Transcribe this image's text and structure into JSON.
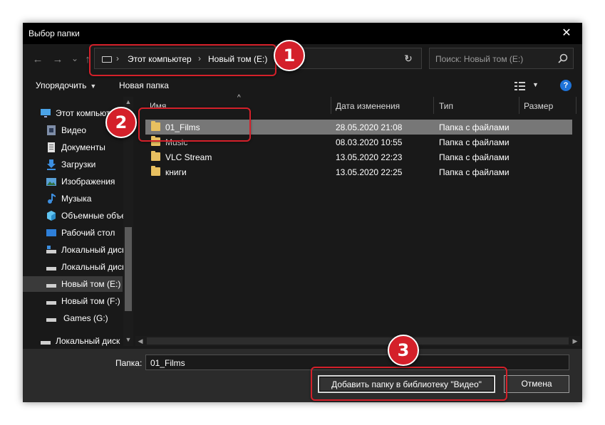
{
  "window": {
    "title": "Выбор папки",
    "close_glyph": "✕"
  },
  "nav": {
    "back_glyph": "←",
    "forward_glyph": "→",
    "history_glyph": "⌄",
    "up_glyph": "↑",
    "breadcrumbs": [
      "Этот компьютер",
      "Новый том (E:)"
    ],
    "crumb_sep": "›",
    "dropdown_glyph": "⌄",
    "refresh_glyph": "↻",
    "search_placeholder": "Поиск: Новый том (E:)"
  },
  "toolbar": {
    "organize": "Упорядочить",
    "new_folder": "Новая папка",
    "dropdown_glyph": "▼",
    "view_dropdown_glyph": "▼",
    "help_glyph": "?"
  },
  "sidebar": {
    "items": [
      {
        "label": "Этот компьютер",
        "icon": "computer-icon"
      },
      {
        "label": "Видео",
        "icon": "video-icon"
      },
      {
        "label": "Документы",
        "icon": "documents-icon"
      },
      {
        "label": "Загрузки",
        "icon": "downloads-icon"
      },
      {
        "label": "Изображения",
        "icon": "pictures-icon"
      },
      {
        "label": "Музыка",
        "icon": "music-icon"
      },
      {
        "label": "Объемные объекты",
        "icon": "3d-objects-icon"
      },
      {
        "label": "Рабочий стол",
        "icon": "desktop-icon"
      },
      {
        "label": "Локальный диск",
        "icon": "drive-icon"
      },
      {
        "label": "Локальный диск",
        "icon": "drive-icon"
      },
      {
        "label": "Новый том (E:)",
        "icon": "drive-icon"
      },
      {
        "label": "Новый том (F:)",
        "icon": "drive-icon"
      },
      {
        "label": "Games (G:)",
        "icon": "drive-icon"
      },
      {
        "label": "Локальный диск",
        "icon": "drive-icon"
      }
    ],
    "selected_index": 10
  },
  "columns": {
    "name": "Имя",
    "date": "Дата изменения",
    "type": "Тип",
    "size": "Размер",
    "sort_glyph": "^"
  },
  "files": [
    {
      "name": "01_Films",
      "date": "28.05.2020 21:08",
      "type": "Папка с файлами",
      "selected": true
    },
    {
      "name": "Music",
      "date": "08.03.2020 10:55",
      "type": "Папка с файлами",
      "selected": false
    },
    {
      "name": "VLC Stream",
      "date": "13.05.2020 22:23",
      "type": "Папка с файлами",
      "selected": false
    },
    {
      "name": "книги",
      "date": "13.05.2020 22:25",
      "type": "Папка с файлами",
      "selected": false
    }
  ],
  "scroll": {
    "up_glyph": "▲",
    "down_glyph": "▼",
    "left_glyph": "◀",
    "right_glyph": "▶"
  },
  "footer": {
    "folder_label": "Папка:",
    "folder_value": "01_Films",
    "add_button": "Добавить папку в библиотеку \"Видео\"",
    "cancel_button": "Отмена"
  },
  "annotations": {
    "n1": "1",
    "n2": "2",
    "n3": "3"
  },
  "colors": {
    "window_bg": "#191919",
    "selection": "#777777",
    "annotation_red": "#d4202a",
    "folder_yellow": "#e8c060"
  }
}
